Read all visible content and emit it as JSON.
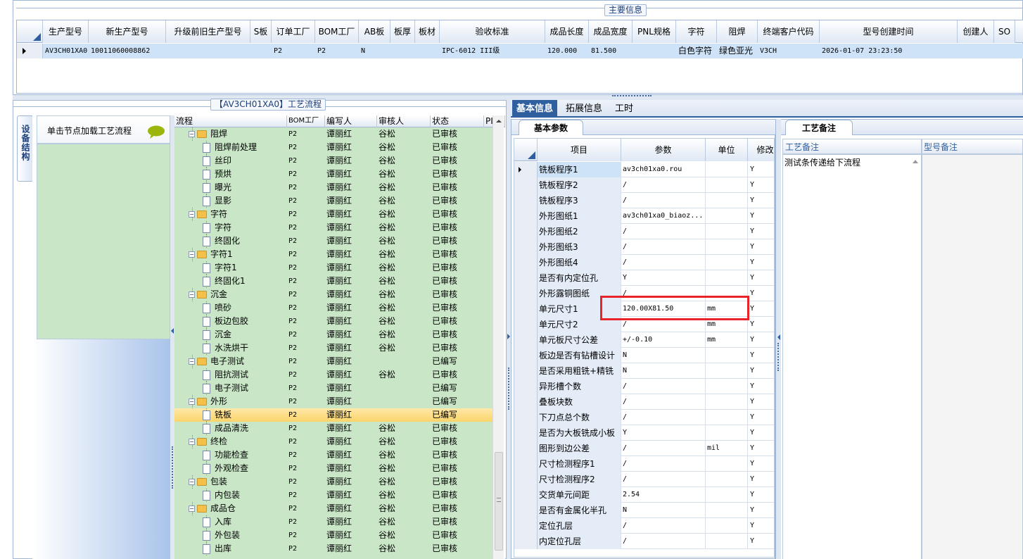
{
  "main_info": {
    "title": "主要信息",
    "columns": [
      "生产型号",
      "新生产型号",
      "升级前旧生产型号",
      "S板",
      "订单工厂",
      "BOM工厂",
      "AB板",
      "板厚",
      "板材",
      "验收标准",
      "成品长度",
      "成品宽度",
      "PNL规格",
      "字符",
      "阻焊",
      "终端客户代码",
      "型号创建时间",
      "创建人",
      "SO"
    ],
    "row": [
      "AV3CH01XA0",
      "10011060008862",
      "",
      "",
      "P2",
      "P2",
      "N",
      "",
      "",
      "IPC-6012 III级",
      "120.000",
      "81.500",
      "",
      "白色字符",
      "绿色亚光",
      "V3CH",
      "2026-01-07 23:23:50",
      "",
      ""
    ]
  },
  "flow_panel": {
    "title": "【AV3CH01XA0】工艺流程",
    "side_tab": "设备结构",
    "load_button": "单击节点加载工艺流程",
    "columns": [
      "流程",
      "BOM工厂",
      "编写人",
      "审核人",
      "状态",
      "PI"
    ],
    "rows": [
      {
        "name": "阻焊",
        "type": "folder",
        "bom": "P2",
        "writer": "谭丽红",
        "reviewer": "谷松",
        "status": "已审核"
      },
      {
        "name": "阻焊前处理",
        "type": "doc",
        "bom": "P2",
        "writer": "谭丽红",
        "reviewer": "谷松",
        "status": "已审核"
      },
      {
        "name": "丝印",
        "type": "doc",
        "bom": "P2",
        "writer": "谭丽红",
        "reviewer": "谷松",
        "status": "已审核"
      },
      {
        "name": "预烘",
        "type": "doc",
        "bom": "P2",
        "writer": "谭丽红",
        "reviewer": "谷松",
        "status": "已审核"
      },
      {
        "name": "曝光",
        "type": "doc",
        "bom": "P2",
        "writer": "谭丽红",
        "reviewer": "谷松",
        "status": "已审核"
      },
      {
        "name": "显影",
        "type": "doc",
        "bom": "P2",
        "writer": "谭丽红",
        "reviewer": "谷松",
        "status": "已审核"
      },
      {
        "name": "字符",
        "type": "folder",
        "bom": "P2",
        "writer": "谭丽红",
        "reviewer": "谷松",
        "status": "已审核"
      },
      {
        "name": "字符",
        "type": "doc",
        "bom": "P2",
        "writer": "谭丽红",
        "reviewer": "谷松",
        "status": "已审核"
      },
      {
        "name": "终固化",
        "type": "doc",
        "bom": "P2",
        "writer": "谭丽红",
        "reviewer": "谷松",
        "status": "已审核"
      },
      {
        "name": "字符1",
        "type": "folder",
        "bom": "P2",
        "writer": "谭丽红",
        "reviewer": "谷松",
        "status": "已审核"
      },
      {
        "name": "字符1",
        "type": "doc",
        "bom": "P2",
        "writer": "谭丽红",
        "reviewer": "谷松",
        "status": "已审核"
      },
      {
        "name": "终固化1",
        "type": "doc",
        "bom": "P2",
        "writer": "谭丽红",
        "reviewer": "谷松",
        "status": "已审核"
      },
      {
        "name": "沉金",
        "type": "folder",
        "bom": "P2",
        "writer": "谭丽红",
        "reviewer": "谷松",
        "status": "已审核"
      },
      {
        "name": "喷砂",
        "type": "doc",
        "bom": "P2",
        "writer": "谭丽红",
        "reviewer": "谷松",
        "status": "已审核"
      },
      {
        "name": "板边包胶",
        "type": "doc",
        "bom": "P2",
        "writer": "谭丽红",
        "reviewer": "谷松",
        "status": "已审核"
      },
      {
        "name": "沉金",
        "type": "doc",
        "bom": "P2",
        "writer": "谭丽红",
        "reviewer": "谷松",
        "status": "已审核"
      },
      {
        "name": "水洗烘干",
        "type": "doc",
        "bom": "P2",
        "writer": "谭丽红",
        "reviewer": "谷松",
        "status": "已审核"
      },
      {
        "name": "电子测试",
        "type": "folder",
        "bom": "P2",
        "writer": "谭丽红",
        "reviewer": "",
        "status": "已编写"
      },
      {
        "name": "阻抗测试",
        "type": "doc",
        "bom": "P2",
        "writer": "谭丽红",
        "reviewer": "谷松",
        "status": "已审核"
      },
      {
        "name": "电子测试",
        "type": "doc",
        "bom": "P2",
        "writer": "谭丽红",
        "reviewer": "",
        "status": "已编写"
      },
      {
        "name": "外形",
        "type": "folder",
        "bom": "P2",
        "writer": "谭丽红",
        "reviewer": "",
        "status": "已编写"
      },
      {
        "name": "铣板",
        "type": "doc",
        "bom": "P2",
        "writer": "谭丽红",
        "reviewer": "",
        "status": "已编写",
        "selected": true
      },
      {
        "name": "成品清洗",
        "type": "doc",
        "bom": "P2",
        "writer": "谭丽红",
        "reviewer": "谷松",
        "status": "已审核"
      },
      {
        "name": "终检",
        "type": "folder",
        "bom": "P2",
        "writer": "谭丽红",
        "reviewer": "谷松",
        "status": "已审核"
      },
      {
        "name": "功能检查",
        "type": "doc",
        "bom": "P2",
        "writer": "谭丽红",
        "reviewer": "谷松",
        "status": "已审核"
      },
      {
        "name": "外观检查",
        "type": "doc",
        "bom": "P2",
        "writer": "谭丽红",
        "reviewer": "谷松",
        "status": "已审核"
      },
      {
        "name": "包装",
        "type": "folder",
        "bom": "P2",
        "writer": "谭丽红",
        "reviewer": "谷松",
        "status": "已审核"
      },
      {
        "name": "内包装",
        "type": "doc",
        "bom": "P2",
        "writer": "谭丽红",
        "reviewer": "谷松",
        "status": "已审核"
      },
      {
        "name": "成品仓",
        "type": "folder",
        "bom": "P2",
        "writer": "谭丽红",
        "reviewer": "谷松",
        "status": "已审核"
      },
      {
        "name": "入库",
        "type": "doc",
        "bom": "P2",
        "writer": "谭丽红",
        "reviewer": "谷松",
        "status": "已审核"
      },
      {
        "name": "外包装",
        "type": "doc",
        "bom": "P2",
        "writer": "谭丽红",
        "reviewer": "谷松",
        "status": "已审核"
      },
      {
        "name": "出库",
        "type": "doc",
        "bom": "P2",
        "writer": "谭丽红",
        "reviewer": "谷松",
        "status": "已审核"
      }
    ]
  },
  "detail": {
    "tabs": [
      "基本信息",
      "拓展信息",
      "工时"
    ],
    "active_tab": "基本信息",
    "sub_tab": "基本参数",
    "columns": [
      "项目",
      "参数",
      "单位",
      "修改"
    ],
    "rows": [
      {
        "item": "铣板程序1",
        "value": "av3ch01xa0.rou",
        "unit": "",
        "mod": "Y"
      },
      {
        "item": "铣板程序2",
        "value": "/",
        "unit": "",
        "mod": "Y"
      },
      {
        "item": "铣板程序3",
        "value": "/",
        "unit": "",
        "mod": "Y"
      },
      {
        "item": "外形图纸1",
        "value": "av3ch01xa0_biaoz...",
        "unit": "",
        "mod": "Y"
      },
      {
        "item": "外形图纸2",
        "value": "/",
        "unit": "",
        "mod": "Y"
      },
      {
        "item": "外形图纸3",
        "value": "/",
        "unit": "",
        "mod": "Y"
      },
      {
        "item": "外形图纸4",
        "value": "/",
        "unit": "",
        "mod": "Y"
      },
      {
        "item": "是否有内定位孔",
        "value": "Y",
        "unit": "",
        "mod": "Y"
      },
      {
        "item": "外形露铜图纸",
        "value": "/",
        "unit": "",
        "mod": "Y"
      },
      {
        "item": "单元尺寸1",
        "value": "120.00X81.50",
        "unit": "mm",
        "mod": "Y",
        "highlight": true
      },
      {
        "item": "单元尺寸2",
        "value": "/",
        "unit": "mm",
        "mod": "Y"
      },
      {
        "item": "单元板尺寸公差",
        "value": "+/-0.10",
        "unit": "mm",
        "mod": "Y"
      },
      {
        "item": "板边是否有钻槽设计",
        "value": "N",
        "unit": "",
        "mod": "Y"
      },
      {
        "item": "是否采用粗铣+精铣",
        "value": "N",
        "unit": "",
        "mod": "Y"
      },
      {
        "item": "异形槽个数",
        "value": "/",
        "unit": "",
        "mod": "Y"
      },
      {
        "item": "叠板块数",
        "value": "/",
        "unit": "",
        "mod": "Y"
      },
      {
        "item": "下刀点总个数",
        "value": "/",
        "unit": "",
        "mod": "Y"
      },
      {
        "item": "是否为大板铣成小板",
        "value": "Y",
        "unit": "",
        "mod": "Y"
      },
      {
        "item": "图形到边公差",
        "value": "/",
        "unit": "mil",
        "mod": "Y"
      },
      {
        "item": "尺寸检测程序1",
        "value": "/",
        "unit": "",
        "mod": "Y"
      },
      {
        "item": "尺寸检测程序2",
        "value": "/",
        "unit": "",
        "mod": "Y"
      },
      {
        "item": "交货单元间距",
        "value": "2.54",
        "unit": "",
        "mod": "Y"
      },
      {
        "item": "是否有金属化半孔",
        "value": "N",
        "unit": "",
        "mod": "Y"
      },
      {
        "item": "定位孔层",
        "value": "/",
        "unit": "",
        "mod": "Y"
      },
      {
        "item": "内定位孔层",
        "value": "/",
        "unit": "",
        "mod": "Y"
      }
    ]
  },
  "remarks": {
    "tab": "工艺备注",
    "col1": "工艺备注",
    "col2": "型号备注",
    "note": "测试条传递给下流程"
  }
}
